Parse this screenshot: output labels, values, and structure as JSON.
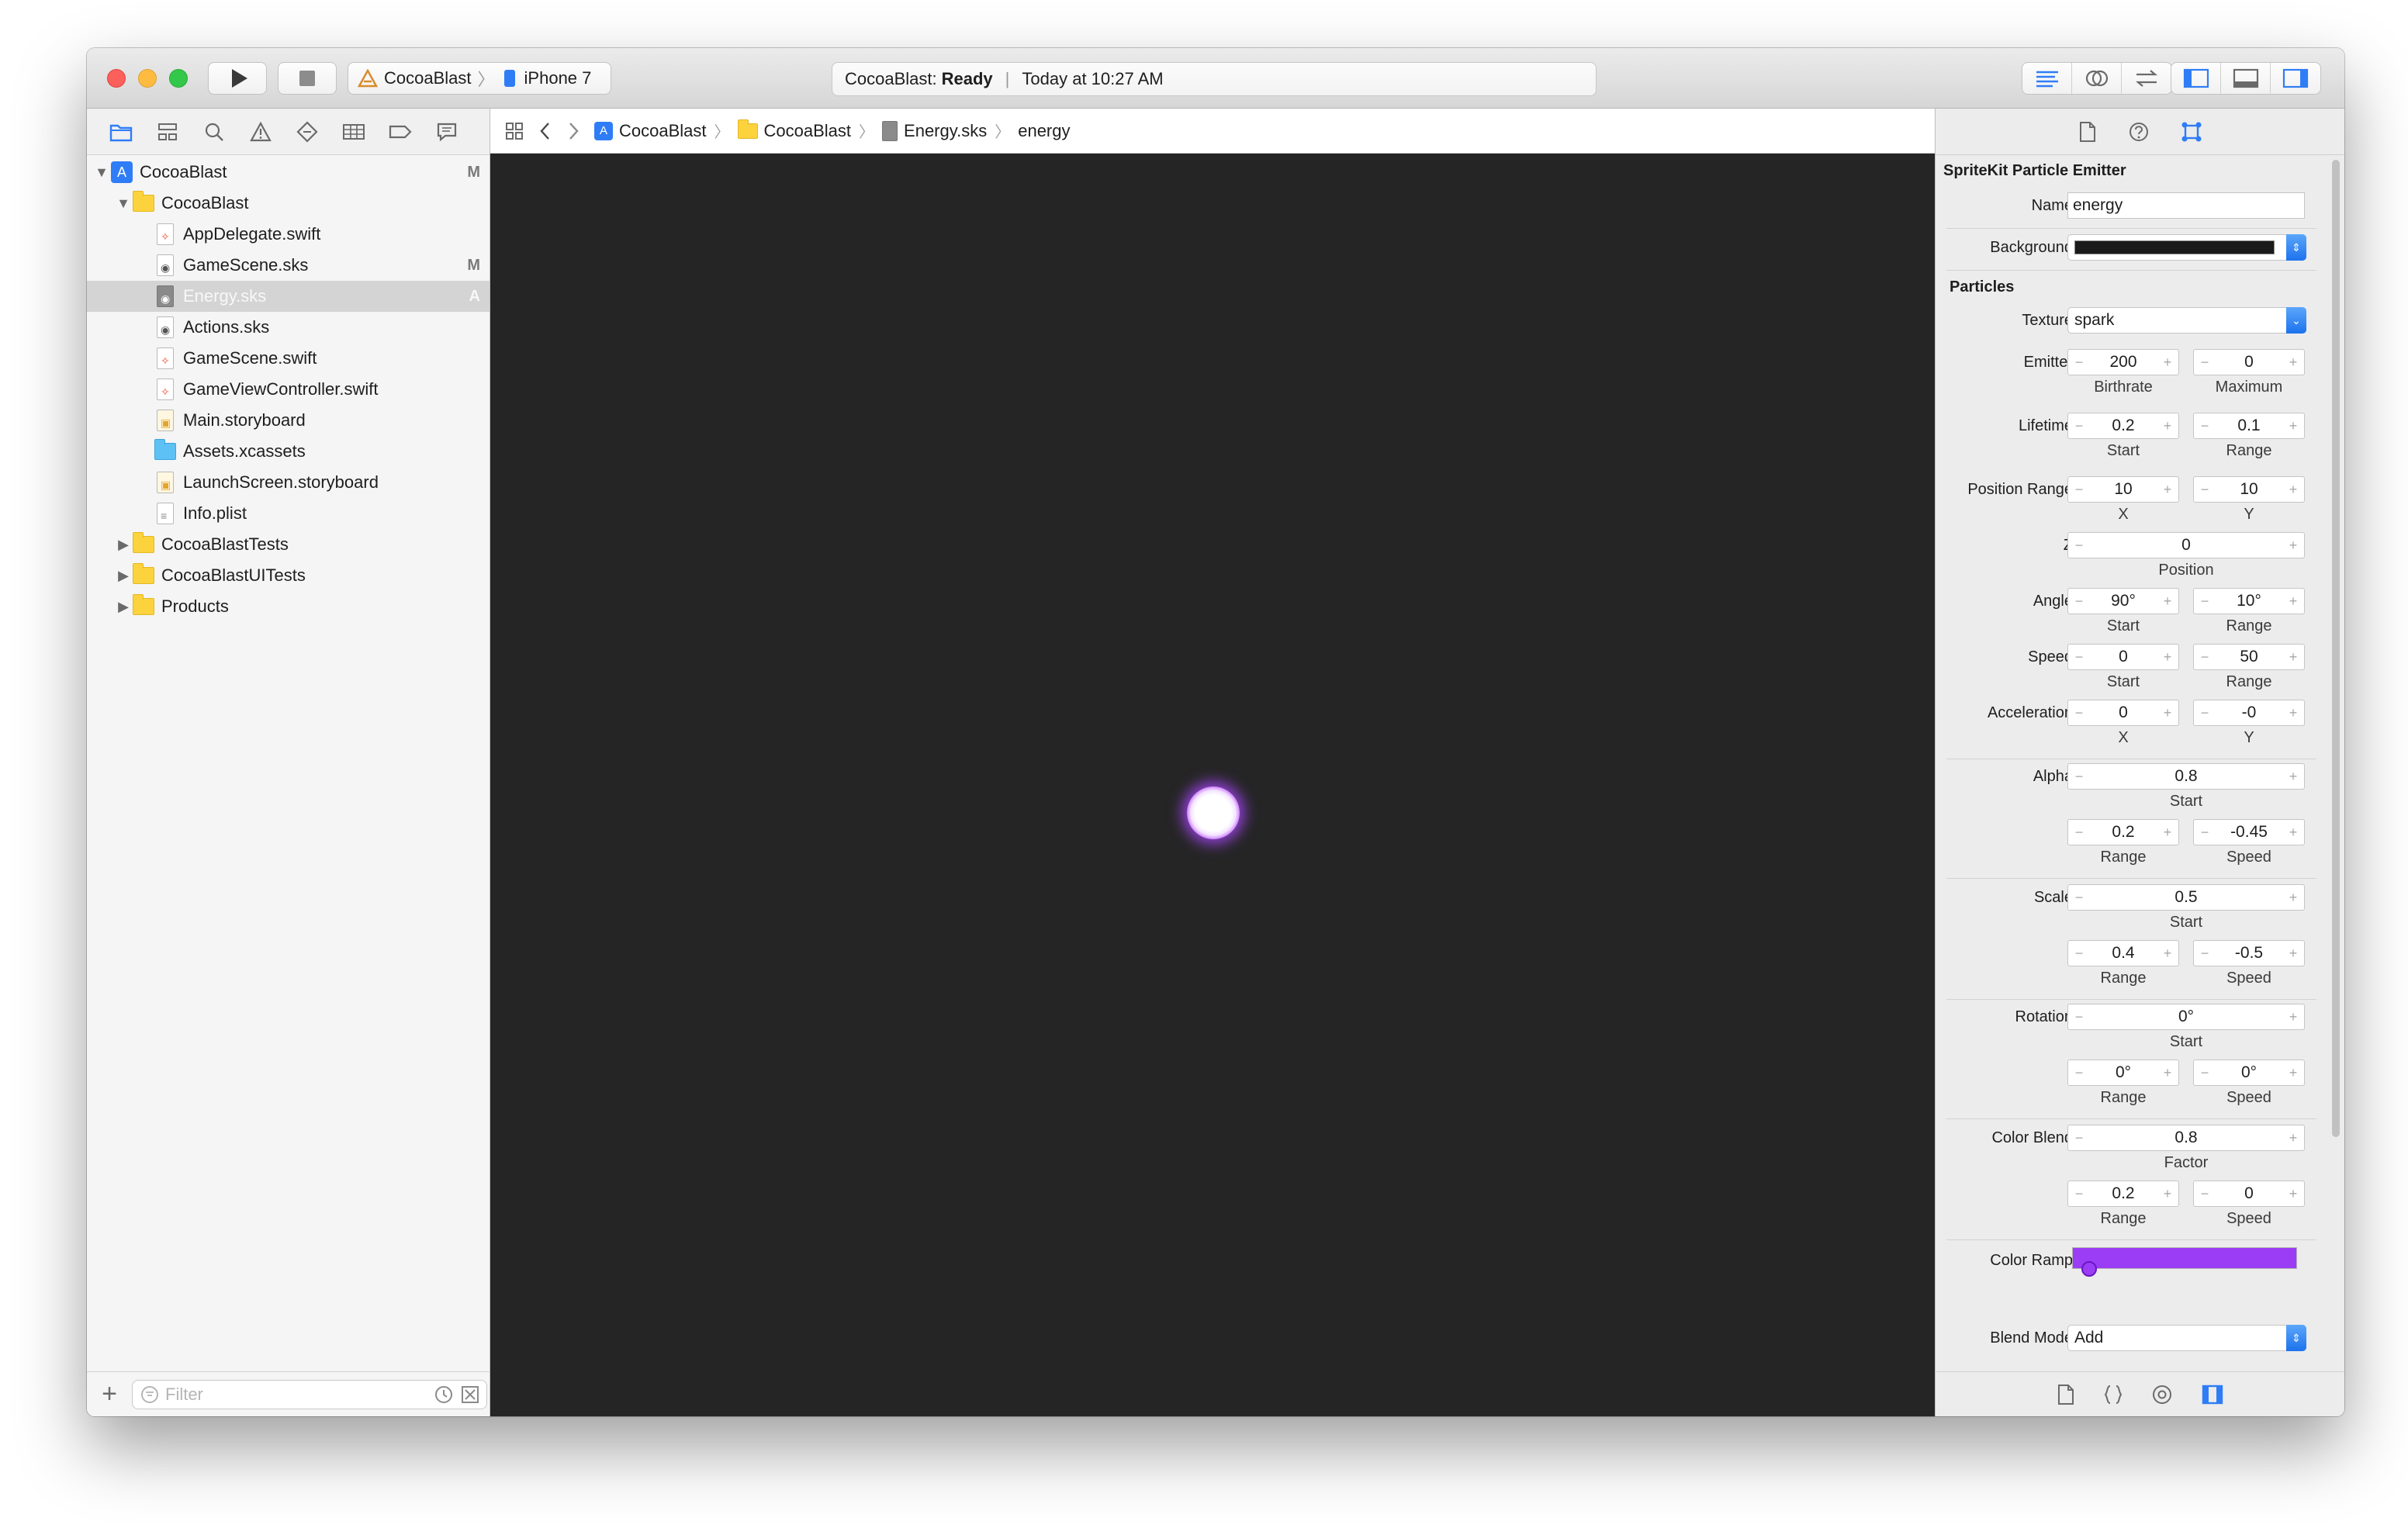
{
  "toolbar": {
    "scheme_name": "CocoaBlast",
    "device_name": "iPhone 7",
    "activity_app": "CocoaBlast:",
    "activity_state": "Ready",
    "activity_time": "Today at 10:27 AM"
  },
  "navigator": {
    "items": [
      {
        "label": "CocoaBlast",
        "badge": "M"
      },
      {
        "label": "CocoaBlast",
        "badge": ""
      },
      {
        "label": "AppDelegate.swift",
        "badge": ""
      },
      {
        "label": "GameScene.sks",
        "badge": "M"
      },
      {
        "label": "Energy.sks",
        "badge": "A"
      },
      {
        "label": "Actions.sks",
        "badge": ""
      },
      {
        "label": "GameScene.swift",
        "badge": ""
      },
      {
        "label": "GameViewController.swift",
        "badge": ""
      },
      {
        "label": "Main.storyboard",
        "badge": ""
      },
      {
        "label": "Assets.xcassets",
        "badge": ""
      },
      {
        "label": "LaunchScreen.storyboard",
        "badge": ""
      },
      {
        "label": "Info.plist",
        "badge": ""
      },
      {
        "label": "CocoaBlastTests",
        "badge": ""
      },
      {
        "label": "CocoaBlastUITests",
        "badge": ""
      },
      {
        "label": "Products",
        "badge": ""
      }
    ],
    "filter_placeholder": "Filter"
  },
  "jumpbar": {
    "crumbs": [
      "CocoaBlast",
      "CocoaBlast",
      "Energy.sks",
      "energy"
    ]
  },
  "inspector": {
    "title": "SpriteKit Particle Emitter",
    "name_label": "Name",
    "name_value": "energy",
    "background_label": "Background",
    "particles_section": "Particles",
    "texture_label": "Texture",
    "texture_value": "spark",
    "emitter": {
      "label": "Emitter",
      "a": "200",
      "b": "0",
      "a_sub": "Birthrate",
      "b_sub": "Maximum"
    },
    "lifetime": {
      "label": "Lifetime",
      "a": "0.2",
      "b": "0.1",
      "a_sub": "Start",
      "b_sub": "Range"
    },
    "position_range": {
      "label": "Position Range",
      "a": "10",
      "b": "10",
      "a_sub": "X",
      "b_sub": "Y"
    },
    "z": {
      "label": "Z",
      "value": "0",
      "sub": "Position"
    },
    "angle": {
      "label": "Angle",
      "a": "90°",
      "b": "10°",
      "a_sub": "Start",
      "b_sub": "Range"
    },
    "speed": {
      "label": "Speed",
      "a": "0",
      "b": "50",
      "a_sub": "Start",
      "b_sub": "Range"
    },
    "acceleration": {
      "label": "Acceleration",
      "a": "0",
      "b": "-0",
      "a_sub": "X",
      "b_sub": "Y"
    },
    "alpha": {
      "label": "Alpha",
      "start": "0.8",
      "start_sub": "Start",
      "a": "0.2",
      "b": "-0.45",
      "a_sub": "Range",
      "b_sub": "Speed"
    },
    "scale": {
      "label": "Scale",
      "start": "0.5",
      "start_sub": "Start",
      "a": "0.4",
      "b": "-0.5",
      "a_sub": "Range",
      "b_sub": "Speed"
    },
    "rotation": {
      "label": "Rotation",
      "start": "0°",
      "start_sub": "Start",
      "a": "0°",
      "b": "0°",
      "a_sub": "Range",
      "b_sub": "Speed"
    },
    "color_blend": {
      "label": "Color Blend",
      "start": "0.8",
      "start_sub": "Factor",
      "a": "0.2",
      "b": "0",
      "a_sub": "Range",
      "b_sub": "Speed"
    },
    "color_ramp_label": "Color Ramp",
    "blend_mode_label": "Blend Mode",
    "blend_mode_value": "Add",
    "stepper_minus": "−",
    "stepper_plus": "+"
  },
  "colors": {
    "scene_background": "#252525",
    "particle_glow": "#b04cff",
    "color_ramp": "#9b3df4",
    "accent": "#1d72ed"
  }
}
